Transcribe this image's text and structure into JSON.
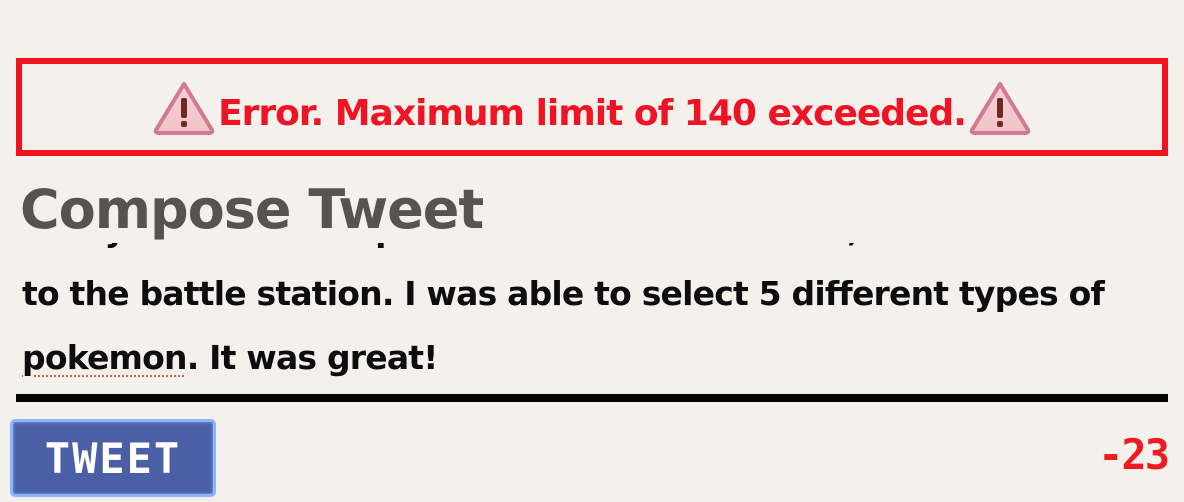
{
  "error": {
    "message": "Error. Maximum limit of 140 exceeded.",
    "left_icon": "warning-triangle-icon",
    "right_icon": "warning-triangle-icon",
    "color": "#ef1323",
    "border_color": "#f0121e"
  },
  "compose": {
    "title": "Compose Tweet",
    "tweet_text_before": "Today I went to the pokemon store at the mall, and then I went to the battle station. I was able to select 5 different types of ",
    "tweet_text_misspelled": "pokemon",
    "tweet_text_after": ". It was great!"
  },
  "footer": {
    "tweet_button_label": "TWEET",
    "remaining_count": "-23",
    "button_color": "#4a5fa6",
    "counter_color": "#f01a22"
  }
}
